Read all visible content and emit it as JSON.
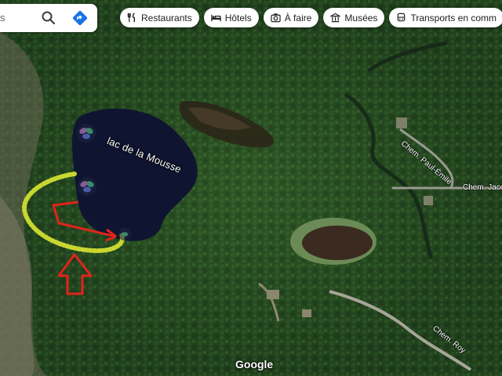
{
  "search": {
    "query_fragment": "s"
  },
  "chips": [
    {
      "label": "Restaurants",
      "icon": "fork-knife-icon"
    },
    {
      "label": "Hôtels",
      "icon": "bed-icon"
    },
    {
      "label": "À faire",
      "icon": "camera-icon"
    },
    {
      "label": "Musées",
      "icon": "museum-icon"
    },
    {
      "label": "Transports en comm",
      "icon": "bus-icon"
    }
  ],
  "map": {
    "lake_label": "lac de la Mousse",
    "roads": [
      "Chem. Paul-Émile",
      "Chem. Jaco",
      "Chem. Roy"
    ],
    "attribution": "Google",
    "colors": {
      "forest": "#244521",
      "lake": "#0f1530",
      "annotation_red": "#e0241c",
      "annotation_yellow": "#c8d630"
    }
  }
}
